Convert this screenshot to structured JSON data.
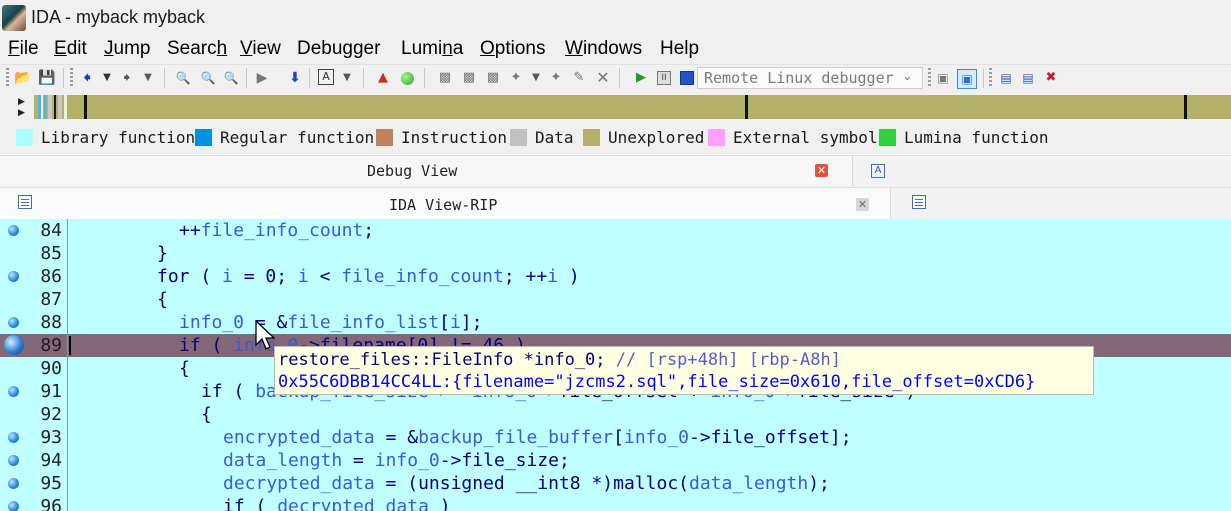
{
  "window": {
    "title": "IDA - myback myback"
  },
  "menu": [
    {
      "pre": "",
      "u": "F",
      "post": "ile"
    },
    {
      "pre": "",
      "u": "E",
      "post": "dit"
    },
    {
      "pre": "",
      "u": "J",
      "post": "ump"
    },
    {
      "pre": "Searc",
      "u": "h",
      "post": ""
    },
    {
      "pre": "",
      "u": "V",
      "post": "iew"
    },
    {
      "pre": "Debugger",
      "u": "",
      "post": ""
    },
    {
      "pre": "Lumi",
      "u": "n",
      "post": "a"
    },
    {
      "pre": "",
      "u": "O",
      "post": "ptions"
    },
    {
      "pre": "",
      "u": "W",
      "post": "indows"
    },
    {
      "pre": "Help",
      "u": "",
      "post": ""
    }
  ],
  "toolbar": {
    "debugger_select": "Remote Linux debugger",
    "icons": [
      "open-icon",
      "save-icon",
      "back-icon",
      "dropdown-icon",
      "forward-icon",
      "dropdown-icon",
      "search-text-icon",
      "search-binary-icon",
      "search-immediate-icon",
      "mark-icon",
      "jump-icon",
      "text-mode-icon",
      "dropdown-icon",
      "graph-icon",
      "run-green-icon",
      "add-seg-icon",
      "add-func-icon",
      "add-struct-icon",
      "add-enum-icon",
      "edit-icon",
      "edit-func-icon",
      "delete-icon",
      "start-icon",
      "pause-icon",
      "stop-icon",
      "attach-icon",
      "detach-icon",
      "trace-icon",
      "step-icon",
      "breakpoint-icon"
    ]
  },
  "legend": [
    {
      "label": "Library function",
      "color": "#aaffff"
    },
    {
      "label": "Regular function",
      "color": "#0090e0"
    },
    {
      "label": "Instruction",
      "color": "#bf8060"
    },
    {
      "label": "Data",
      "color": "#c0c0c0"
    },
    {
      "label": "Unexplored",
      "color": "#b5b06a"
    },
    {
      "label": "External symbol",
      "color": "#ffa0ff"
    },
    {
      "label": "Lumina function",
      "color": "#30d040"
    }
  ],
  "tabs": {
    "debug_view": "Debug View",
    "ida_view": "IDA View-RIP"
  },
  "code": [
    {
      "n": "84",
      "dot": true,
      "indent": 10,
      "tokens": [
        [
          "op",
          "++"
        ],
        [
          "id",
          "file_info_count"
        ],
        [
          "op",
          ";"
        ]
      ]
    },
    {
      "n": "85",
      "dot": false,
      "indent": 8,
      "tokens": [
        [
          "op",
          "}"
        ]
      ]
    },
    {
      "n": "86",
      "dot": true,
      "indent": 8,
      "tokens": [
        [
          "op",
          "for ( "
        ],
        [
          "id",
          "i"
        ],
        [
          "op",
          " = 0; "
        ],
        [
          "id",
          "i"
        ],
        [
          "op",
          " < "
        ],
        [
          "id",
          "file_info_count"
        ],
        [
          "op",
          "; ++"
        ],
        [
          "id",
          "i"
        ],
        [
          "op",
          " )"
        ]
      ]
    },
    {
      "n": "87",
      "dot": false,
      "indent": 8,
      "tokens": [
        [
          "op",
          "{"
        ]
      ]
    },
    {
      "n": "88",
      "dot": true,
      "indent": 10,
      "tokens": [
        [
          "id",
          "info_0"
        ],
        [
          "op",
          " = &"
        ],
        [
          "id",
          "file_info_list"
        ],
        [
          "op",
          "["
        ],
        [
          "id",
          "i"
        ],
        [
          "op",
          "];"
        ]
      ]
    },
    {
      "n": "89",
      "dot": true,
      "indent": 10,
      "current": true,
      "tokens": [
        [
          "op",
          "if ( "
        ],
        [
          "id",
          "info_0"
        ],
        [
          "op",
          "->filename[0] != 46 )"
        ]
      ]
    },
    {
      "n": "90",
      "dot": false,
      "indent": 10,
      "tokens": [
        [
          "op",
          "{"
        ]
      ]
    },
    {
      "n": "91",
      "dot": true,
      "indent": 12,
      "tokens": [
        [
          "op",
          "if ( "
        ],
        [
          "id",
          "backup_file_size"
        ],
        [
          "op",
          " >= "
        ],
        [
          "id",
          "info_0"
        ],
        [
          "op",
          "->file_offset + "
        ],
        [
          "id",
          "info_0"
        ],
        [
          "op",
          "->file_size )"
        ]
      ]
    },
    {
      "n": "92",
      "dot": false,
      "indent": 12,
      "tokens": [
        [
          "op",
          "{"
        ]
      ]
    },
    {
      "n": "93",
      "dot": true,
      "indent": 14,
      "tokens": [
        [
          "id",
          "encrypted_data"
        ],
        [
          "op",
          " = &"
        ],
        [
          "id",
          "backup_file_buffer"
        ],
        [
          "op",
          "["
        ],
        [
          "id",
          "info_0"
        ],
        [
          "op",
          "->file_offset];"
        ]
      ]
    },
    {
      "n": "94",
      "dot": true,
      "indent": 14,
      "tokens": [
        [
          "id",
          "data_length"
        ],
        [
          "op",
          " = "
        ],
        [
          "id",
          "info_0"
        ],
        [
          "op",
          "->file_size;"
        ]
      ]
    },
    {
      "n": "95",
      "dot": true,
      "indent": 14,
      "tokens": [
        [
          "id",
          "decrypted_data"
        ],
        [
          "op",
          " = (unsigned __int8 *)malloc("
        ],
        [
          "id",
          "data_length"
        ],
        [
          "op",
          ");"
        ]
      ]
    },
    {
      "n": "96",
      "dot": true,
      "indent": 14,
      "tokens": [
        [
          "op",
          "if ( "
        ],
        [
          "id",
          "decrypted_data"
        ],
        [
          "op",
          " )"
        ]
      ]
    }
  ],
  "tooltip": {
    "line1_decl": "restore_files::FileInfo *info_0; ",
    "line1_comment": "// [rsp+48h] [rbp-A8h]",
    "line2": "0x55C6DBB14CC4LL:{filename=\"jzcms2.sql\",file_size=0x610,file_offset=0xCD6}"
  }
}
